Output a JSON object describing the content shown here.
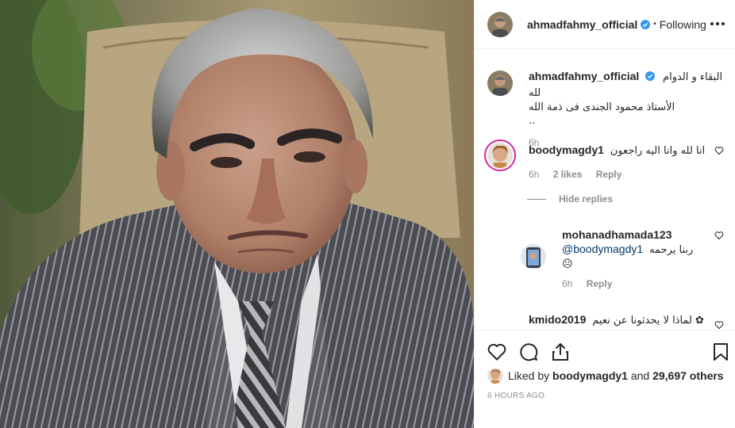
{
  "post": {
    "username": "ahmadfahmy_official",
    "follow_status": "Following",
    "dot": "•",
    "photo_icon": "portrait-photo",
    "verified_icon": "verified-badge-icon",
    "caption": {
      "line1": "البقاء و الدوام لله",
      "line2": "الأستاذ محمود الجندى فى ذمة الله",
      "line3": "..",
      "time": "6h"
    }
  },
  "comments": [
    {
      "username": "boodymagdy1",
      "text": "انا لله وانا اليه راجعون",
      "time": "6h",
      "likes": "2 likes",
      "reply_label": "Reply",
      "hide_replies_label": "Hide replies"
    },
    {
      "username": "mohanadhamada123",
      "text": "ربنا يرحمه",
      "mention": "@boodymagdy1",
      "emoji": "☹",
      "time": "6h",
      "reply_label": "Reply"
    },
    {
      "username": "kmido2019",
      "text": "لماذا لا يحدثونا عن نعيم ✿"
    }
  ],
  "likes": {
    "prefix": "Liked by",
    "user": "boodymagdy1",
    "and": "and",
    "others": "29,697 others"
  },
  "time_ago": "6 HOURS AGO",
  "colors": {
    "text": "#262626",
    "muted": "#8e8e8e",
    "verified": "#3897f0",
    "mention": "#00376b",
    "story_ring": "#d6249f"
  }
}
